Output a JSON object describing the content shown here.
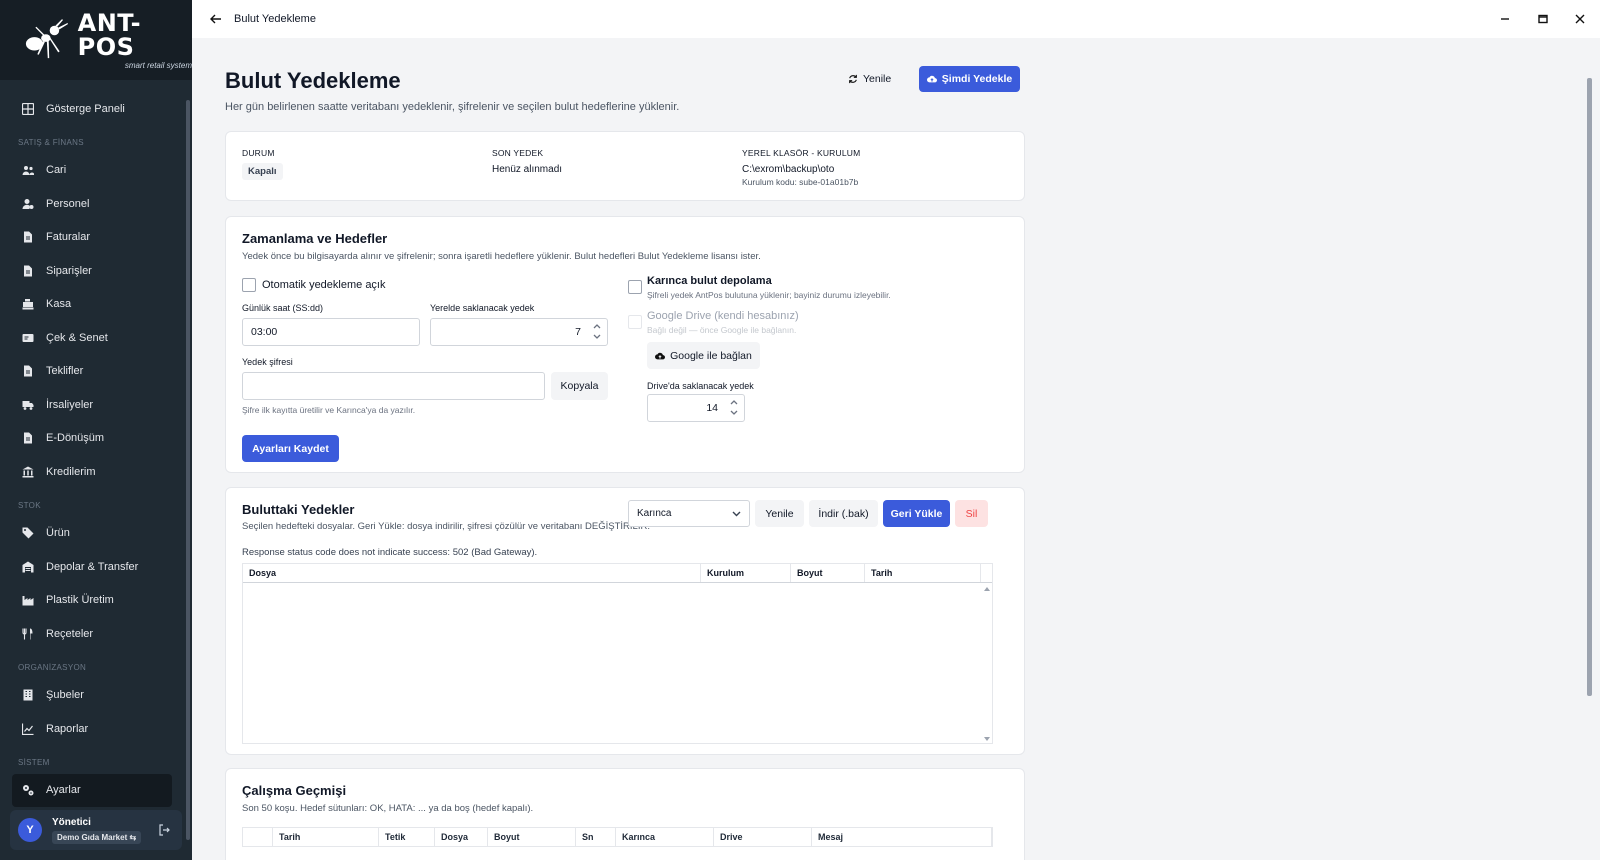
{
  "brand": {
    "name": "ANT-POS",
    "tagline": "smart retail system"
  },
  "sidebar": {
    "top_items": [
      {
        "label": "Gösterge Paneli",
        "icon": "dashboard-icon"
      }
    ],
    "sections": [
      {
        "title": "SATIŞ & FİNANS",
        "items": [
          {
            "label": "Cari",
            "icon": "users-icon"
          },
          {
            "label": "Personel",
            "icon": "user-gear-icon"
          },
          {
            "label": "Faturalar",
            "icon": "file-icon"
          },
          {
            "label": "Siparişler",
            "icon": "file-icon"
          },
          {
            "label": "Kasa",
            "icon": "cash-register-icon"
          },
          {
            "label": "Çek & Senet",
            "icon": "money-check-icon"
          },
          {
            "label": "Teklifler",
            "icon": "file-icon"
          },
          {
            "label": "İrsaliyeler",
            "icon": "truck-icon"
          },
          {
            "label": "E-Dönüşüm",
            "icon": "file-icon"
          },
          {
            "label": "Kredilerim",
            "icon": "bank-icon"
          }
        ]
      },
      {
        "title": "STOK",
        "items": [
          {
            "label": "Ürün",
            "icon": "tag-icon"
          },
          {
            "label": "Depolar & Transfer",
            "icon": "warehouse-icon"
          },
          {
            "label": "Plastik Üretim",
            "icon": "factory-icon"
          },
          {
            "label": "Reçeteler",
            "icon": "utensils-icon"
          }
        ]
      },
      {
        "title": "ORGANİZASYON",
        "items": [
          {
            "label": "Şubeler",
            "icon": "building-icon"
          },
          {
            "label": "Raporlar",
            "icon": "chart-line-icon"
          }
        ]
      },
      {
        "title": "SİSTEM",
        "items": [
          {
            "label": "Ayarlar",
            "icon": "gears-icon",
            "active": true
          }
        ]
      }
    ],
    "user": {
      "initial": "Y",
      "name": "Yönetici",
      "store": "Demo Gıda Market ⇆"
    }
  },
  "topbar": {
    "title": "Bulut Yedekleme"
  },
  "page": {
    "title": "Bulut Yedekleme",
    "description": "Her gün belirlenen saatte veritabanı yedeklenir, şifrelenir ve seçilen bulut hedeflerine yüklenir.",
    "refresh_label": "Yenile",
    "backup_now_label": "Şimdi Yedekle"
  },
  "status": {
    "state_label": "DURUM",
    "state_value": "Kapalı",
    "last_label": "SON YEDEK",
    "last_value": "Henüz alınmadı",
    "folder_label": "YEREL KLASÖR - KURULUM",
    "folder_value": "C:\\exrom\\backup\\oto",
    "install_code": "Kurulum kodu: sube-01a01b7b"
  },
  "schedule": {
    "title": "Zamanlama ve Hedefler",
    "desc": "Yedek önce bu bilgisayarda alınır ve şifrelenir; sonra işaretli hedeflere yüklenir. Bulut hedefleri Bulut Yedekleme lisansı ister.",
    "auto_label": "Otomatik yedekleme açık",
    "time_label": "Günlük saat (SS:dd)",
    "time_value": "03:00",
    "keep_local_label": "Yerelde saklanacak yedek",
    "keep_local_value": "7",
    "password_label": "Yedek şifresi",
    "password_value": "",
    "copy_label": "Kopyala",
    "password_hint": "Şifre ilk kayıtta üretilir ve Karınca'ya da yazılır.",
    "karinca_label": "Karınca bulut depolama",
    "karinca_hint": "Şifreli yedek AntPos bulutuna yüklenir; bayiniz durumu izleyebilir.",
    "gdrive_label": "Google Drive (kendi hesabınız)",
    "gdrive_hint": "Bağlı değil — önce Google ile bağlanın.",
    "google_connect_label": "Google ile bağlan",
    "keep_drive_label": "Drive'da saklanacak yedek",
    "keep_drive_value": "14",
    "save_label": "Ayarları Kaydet"
  },
  "cloud": {
    "title": "Buluttaki Yedekler",
    "desc": "Seçilen hedefteki dosyalar. Geri Yükle: dosya indirilir, şifresi çözülür ve veritabanı DEĞİŞTİRİLİR.",
    "target_value": "Karınca",
    "refresh_label": "Yenile",
    "download_label": "İndir (.bak)",
    "restore_label": "Geri Yükle",
    "delete_label": "Sil",
    "error": "Response status code does not indicate success: 502 (Bad Gateway).",
    "columns": [
      "Dosya",
      "Kurulum",
      "Boyut",
      "Tarih"
    ]
  },
  "history": {
    "title": "Çalışma Geçmişi",
    "desc": "Son 50 koşu. Hedef sütunları: OK, HATA: ... ya da boş (hedef kapalı).",
    "columns": [
      "",
      "Tarih",
      "Tetik",
      "Dosya",
      "Boyut",
      "Sn",
      "Karınca",
      "Drive",
      "Mesaj"
    ]
  }
}
